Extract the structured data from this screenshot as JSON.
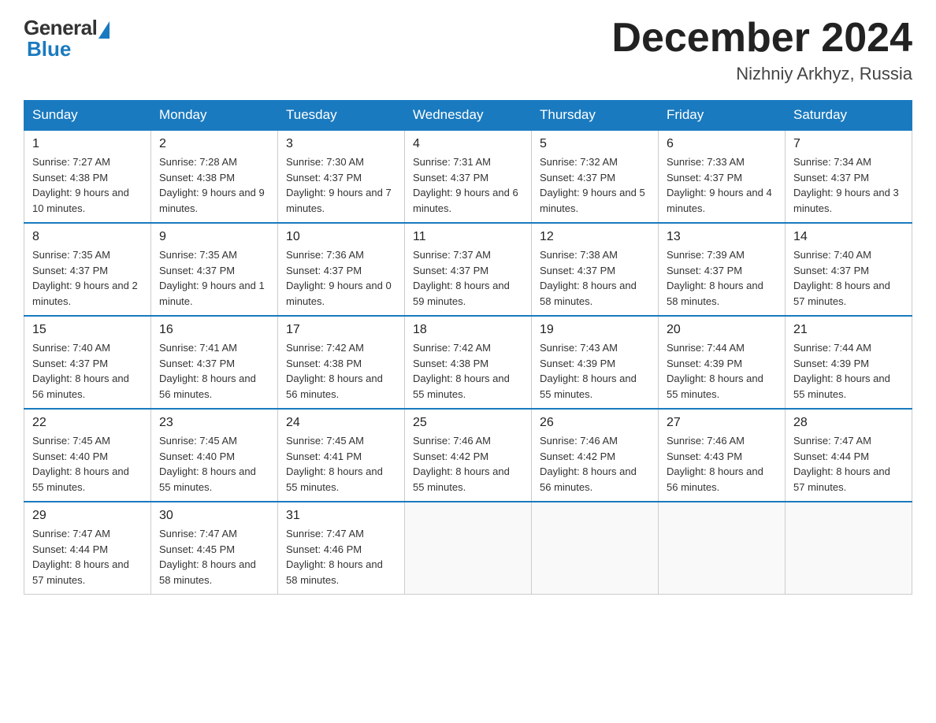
{
  "header": {
    "logo_general": "General",
    "logo_blue": "Blue",
    "month_title": "December 2024",
    "location": "Nizhniy Arkhyz, Russia"
  },
  "days_of_week": [
    "Sunday",
    "Monday",
    "Tuesday",
    "Wednesday",
    "Thursday",
    "Friday",
    "Saturday"
  ],
  "weeks": [
    [
      {
        "day": "1",
        "sunrise": "7:27 AM",
        "sunset": "4:38 PM",
        "daylight": "9 hours and 10 minutes."
      },
      {
        "day": "2",
        "sunrise": "7:28 AM",
        "sunset": "4:38 PM",
        "daylight": "9 hours and 9 minutes."
      },
      {
        "day": "3",
        "sunrise": "7:30 AM",
        "sunset": "4:37 PM",
        "daylight": "9 hours and 7 minutes."
      },
      {
        "day": "4",
        "sunrise": "7:31 AM",
        "sunset": "4:37 PM",
        "daylight": "9 hours and 6 minutes."
      },
      {
        "day": "5",
        "sunrise": "7:32 AM",
        "sunset": "4:37 PM",
        "daylight": "9 hours and 5 minutes."
      },
      {
        "day": "6",
        "sunrise": "7:33 AM",
        "sunset": "4:37 PM",
        "daylight": "9 hours and 4 minutes."
      },
      {
        "day": "7",
        "sunrise": "7:34 AM",
        "sunset": "4:37 PM",
        "daylight": "9 hours and 3 minutes."
      }
    ],
    [
      {
        "day": "8",
        "sunrise": "7:35 AM",
        "sunset": "4:37 PM",
        "daylight": "9 hours and 2 minutes."
      },
      {
        "day": "9",
        "sunrise": "7:35 AM",
        "sunset": "4:37 PM",
        "daylight": "9 hours and 1 minute."
      },
      {
        "day": "10",
        "sunrise": "7:36 AM",
        "sunset": "4:37 PM",
        "daylight": "9 hours and 0 minutes."
      },
      {
        "day": "11",
        "sunrise": "7:37 AM",
        "sunset": "4:37 PM",
        "daylight": "8 hours and 59 minutes."
      },
      {
        "day": "12",
        "sunrise": "7:38 AM",
        "sunset": "4:37 PM",
        "daylight": "8 hours and 58 minutes."
      },
      {
        "day": "13",
        "sunrise": "7:39 AM",
        "sunset": "4:37 PM",
        "daylight": "8 hours and 58 minutes."
      },
      {
        "day": "14",
        "sunrise": "7:40 AM",
        "sunset": "4:37 PM",
        "daylight": "8 hours and 57 minutes."
      }
    ],
    [
      {
        "day": "15",
        "sunrise": "7:40 AM",
        "sunset": "4:37 PM",
        "daylight": "8 hours and 56 minutes."
      },
      {
        "day": "16",
        "sunrise": "7:41 AM",
        "sunset": "4:37 PM",
        "daylight": "8 hours and 56 minutes."
      },
      {
        "day": "17",
        "sunrise": "7:42 AM",
        "sunset": "4:38 PM",
        "daylight": "8 hours and 56 minutes."
      },
      {
        "day": "18",
        "sunrise": "7:42 AM",
        "sunset": "4:38 PM",
        "daylight": "8 hours and 55 minutes."
      },
      {
        "day": "19",
        "sunrise": "7:43 AM",
        "sunset": "4:39 PM",
        "daylight": "8 hours and 55 minutes."
      },
      {
        "day": "20",
        "sunrise": "7:44 AM",
        "sunset": "4:39 PM",
        "daylight": "8 hours and 55 minutes."
      },
      {
        "day": "21",
        "sunrise": "7:44 AM",
        "sunset": "4:39 PM",
        "daylight": "8 hours and 55 minutes."
      }
    ],
    [
      {
        "day": "22",
        "sunrise": "7:45 AM",
        "sunset": "4:40 PM",
        "daylight": "8 hours and 55 minutes."
      },
      {
        "day": "23",
        "sunrise": "7:45 AM",
        "sunset": "4:40 PM",
        "daylight": "8 hours and 55 minutes."
      },
      {
        "day": "24",
        "sunrise": "7:45 AM",
        "sunset": "4:41 PM",
        "daylight": "8 hours and 55 minutes."
      },
      {
        "day": "25",
        "sunrise": "7:46 AM",
        "sunset": "4:42 PM",
        "daylight": "8 hours and 55 minutes."
      },
      {
        "day": "26",
        "sunrise": "7:46 AM",
        "sunset": "4:42 PM",
        "daylight": "8 hours and 56 minutes."
      },
      {
        "day": "27",
        "sunrise": "7:46 AM",
        "sunset": "4:43 PM",
        "daylight": "8 hours and 56 minutes."
      },
      {
        "day": "28",
        "sunrise": "7:47 AM",
        "sunset": "4:44 PM",
        "daylight": "8 hours and 57 minutes."
      }
    ],
    [
      {
        "day": "29",
        "sunrise": "7:47 AM",
        "sunset": "4:44 PM",
        "daylight": "8 hours and 57 minutes."
      },
      {
        "day": "30",
        "sunrise": "7:47 AM",
        "sunset": "4:45 PM",
        "daylight": "8 hours and 58 minutes."
      },
      {
        "day": "31",
        "sunrise": "7:47 AM",
        "sunset": "4:46 PM",
        "daylight": "8 hours and 58 minutes."
      },
      null,
      null,
      null,
      null
    ]
  ]
}
